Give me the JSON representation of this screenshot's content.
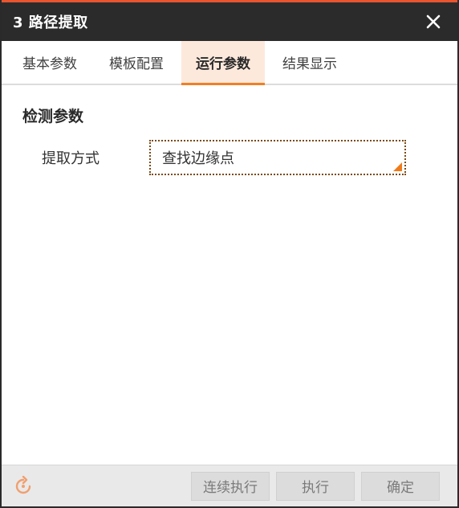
{
  "window": {
    "title": "3 路径提取",
    "close_icon": "close-icon"
  },
  "tabs": [
    {
      "label": "基本参数",
      "active": false
    },
    {
      "label": "模板配置",
      "active": false
    },
    {
      "label": "运行参数",
      "active": true
    },
    {
      "label": "结果显示",
      "active": false
    }
  ],
  "section": {
    "title": "检测参数",
    "params": [
      {
        "label": "提取方式",
        "value": "查找边缘点"
      }
    ]
  },
  "footer": {
    "refresh_icon": "refresh-icon",
    "continuous_label": "连续执行",
    "execute_label": "执行",
    "ok_label": "确定"
  },
  "colors": {
    "accent": "#f08024",
    "titlebar_bg": "#2b2b2b",
    "active_tab_bg": "#fde9dc"
  }
}
